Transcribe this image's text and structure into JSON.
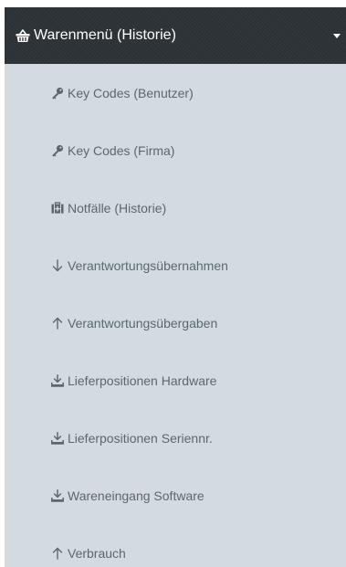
{
  "menu": {
    "title": "Warenmenü (Historie)",
    "icon": "basket-icon",
    "expanded": true,
    "colors": {
      "header_bg": "#2c3136",
      "submenu_bg": "#d4dbe0",
      "item_text": "#5b6770",
      "header_text": "#ffffff"
    },
    "items": [
      {
        "label": "Key Codes (Benutzer)",
        "icon": "key-icon"
      },
      {
        "label": "Key Codes (Firma)",
        "icon": "key-icon"
      },
      {
        "label": "Notfälle (Historie)",
        "icon": "medkit-icon"
      },
      {
        "label": "Verantwortungsübernahmen",
        "icon": "arrow-down-icon"
      },
      {
        "label": "Verantwortungsübergaben",
        "icon": "arrow-up-icon"
      },
      {
        "label": "Lieferpositionen Hardware",
        "icon": "download-icon"
      },
      {
        "label": "Lieferpositionen Seriennr.",
        "icon": "download-icon"
      },
      {
        "label": "Wareneingang Software",
        "icon": "download-icon"
      },
      {
        "label": "Verbrauch",
        "icon": "arrow-up-icon"
      }
    ]
  }
}
